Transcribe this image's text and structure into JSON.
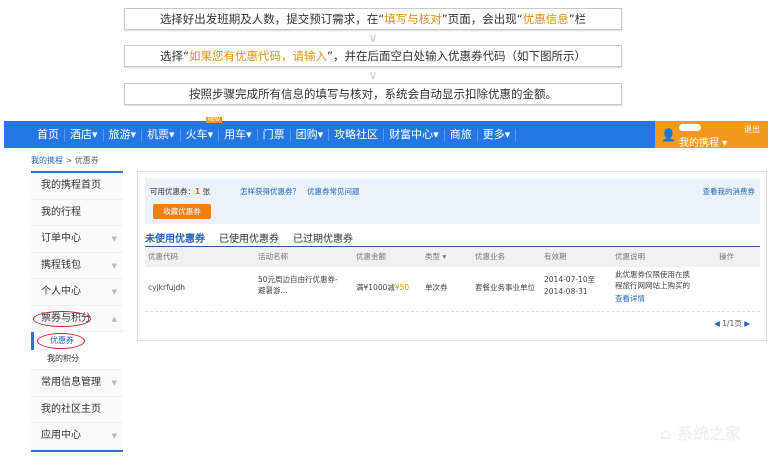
{
  "steps": {
    "s1": {
      "a": "选择好出发班期及人数，提交预订需求，在“",
      "b": "填写与核对",
      "c": "”页面，会出现“",
      "d": "优惠信息",
      "e": "”栏"
    },
    "s2": {
      "a": "选择“",
      "b": "如果您有优惠代码，请输入",
      "c": "”，并在后面空白处输入优惠券代码（如下图所示）"
    },
    "s3": "按照步骤完成所有信息的填写与核对，系统会自动显示扣除优惠的金额。"
  },
  "nav": {
    "items": [
      "首页",
      "酒店▾",
      "旅游▾",
      "机票▾",
      "火车▾",
      "用车▾",
      "门票",
      "团购▾",
      "攻略社区",
      "财富中心▾",
      "商旅",
      "更多▾"
    ],
    "new_badge": "NEW",
    "my_ctrip": "我的携程 ▾",
    "logout": "退出"
  },
  "breadcrumb": {
    "home": "我的携程",
    "sep": " > ",
    "current": "优惠券"
  },
  "sidebar": {
    "items": [
      "我的携程首页",
      "我的行程",
      "订单中心",
      "携程钱包",
      "个人中心",
      "票券与积分"
    ],
    "sub": [
      "优惠券",
      "我的积分"
    ],
    "items2": [
      "常用信息管理",
      "我的社区主页",
      "应用中心"
    ]
  },
  "main": {
    "available_label": "可用优惠券：",
    "available_count": "1",
    "available_unit": "张",
    "how_link": "怎样获得优惠券？",
    "faq_link": "优惠券常见问题",
    "view_link": "查看我的消费券",
    "collect_button": "收藏优惠券",
    "tabs": [
      "未使用优惠券",
      "已使用优惠券",
      "已过期优惠券"
    ],
    "columns": [
      "优惠代码",
      "活动名称",
      "优惠金额",
      "类型 ▾",
      "优惠业务",
      "有效期",
      "优惠说明",
      "操作"
    ],
    "row": {
      "code": "cyjkrfujdh",
      "name": "50元周边自由行优惠券-避暑游...",
      "amount_pre": "满¥1000减",
      "amount_val": "¥50",
      "type": "单次券",
      "biz": "套餐业务事业单位",
      "date1": "2014-07-10至",
      "date2": "2014-08-31",
      "desc": "此优惠券仅限使用在携程旅行网网站上购买的",
      "detail": "查看详情"
    },
    "pager": "1/1页"
  },
  "watermark": "系统之家"
}
